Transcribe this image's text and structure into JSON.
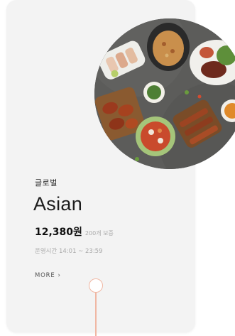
{
  "card": {
    "category": "글로벌",
    "title": "Asian",
    "price": "12,380원",
    "gram": "200개 보증",
    "hours": "운영시간 14:01 ~ 23:59",
    "more_label": "MORE",
    "more_chevron": "›"
  },
  "colors": {
    "card_bg": "#f3f3f3",
    "accent": "#f0b7a3"
  }
}
